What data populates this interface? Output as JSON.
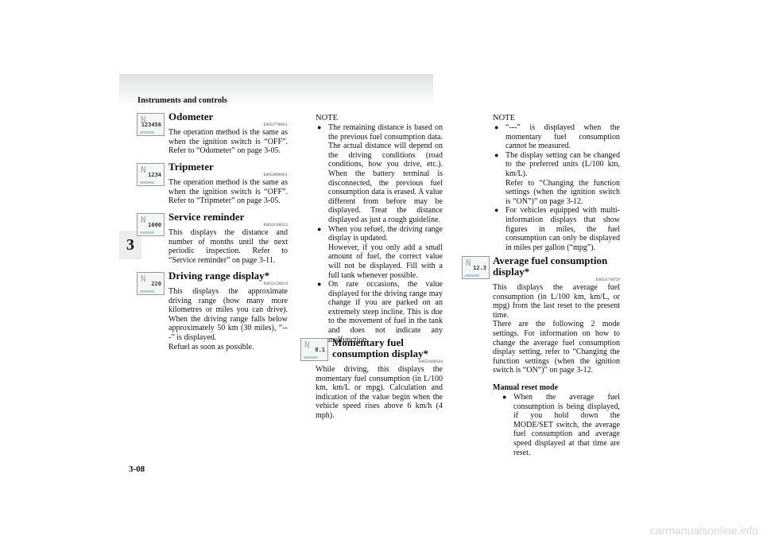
{
  "header": {
    "title": "Instruments and controls"
  },
  "chapter_tab": "3",
  "sections": [
    {
      "title": "Odometer",
      "code": "E00527700011",
      "icon_value": "123456",
      "body": "The operation method is the same as when the ignition switch is “OFF”. Refer to “Odometer” on page 3-05."
    },
    {
      "title": "Tripmeter",
      "code": "E00528000011",
      "icon_value": "1234",
      "body": "The operation method is the same as when the ignition switch is “OFF”. Refer to “Tripmeter” on page 3-05."
    },
    {
      "title": "Service reminder",
      "code": "E00521300552",
      "icon_value": "1000",
      "body": "This displays the distance and number of months until the next periodic inspection. Refer to “Service reminder” on page 3-11."
    },
    {
      "title": "Driving range display*",
      "code": "E00521500219",
      "icon_value": "220",
      "body": "This displays the approximate driving range (how many more kilometres or miles you can drive). When the driving range falls below approximately 50 km (30 miles), “---” is displayed.",
      "body2": "Refuel as soon as possible."
    },
    {
      "title": "Momentary fuel consumption display*",
      "code": "E00521800544",
      "icon_value": "8.1",
      "body": "While driving, this displays the momentary fuel consumption (in L/100 km, km/L or mpg). Calculation and indication of the value begin when the vehicle speed rises above 6 km/h (4 mph)."
    },
    {
      "title": "Average fuel consumption display*",
      "code": "E00521700729",
      "icon_value": "12.3",
      "body": "This displays the average fuel consumption (in L/100 km, km/L, or mpg) from the last reset to the present time.",
      "body2": "There are the following 2 mode settings. For information on how to change the average fuel consumption display setting, refer to “Changing the function settings (when the ignition switch is “ON”)” on page 3-12."
    }
  ],
  "note1": {
    "label": "NOTE",
    "items": [
      "The remaining distance is based on the previous fuel consumption data. The actual distance will depend on the driving conditions (road conditions, how you drive, etc.). When the battery terminal is disconnected, the previous fuel consumption data is erased. A value different from before may be displayed. Treat the distance displayed as just a rough guideline.",
      "When you refuel, the driving range display is updated.",
      "However, if you only add a small amount of fuel, the correct value will not be displayed. Fill with a full tank whenever possible.",
      "On rare occasions, the value displayed for the driving range may change if you are parked on an extremely steep incline. This is due to the movement of fuel in the tank and does not indicate any malfunction."
    ]
  },
  "note2": {
    "label": "NOTE",
    "items": [
      "“---” is displayed when the momentary fuel consumption cannot be measured.",
      "The display setting can be changed to the preferred units (L/100 km, km/L).",
      "Refer to “Changing the function settings (when the ignition switch is “ON”)” on page 3-12.",
      "For vehicles equipped with multi-information displays that show figures in miles, the fuel consumption can only be displayed in miles per gallon (“mpg”)."
    ]
  },
  "manual_reset": {
    "title": "Manual reset mode",
    "items": [
      "When the average fuel consumption is being displayed, if you hold down the MODE/SET switch, the average fuel consumption and average speed displayed at that time are reset."
    ]
  },
  "footer": {
    "page": "3-08"
  },
  "watermark": "carmanualsonline.info"
}
